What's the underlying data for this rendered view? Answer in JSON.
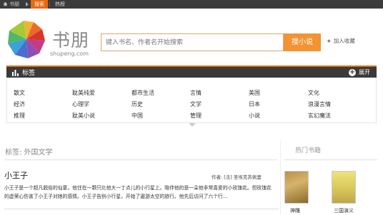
{
  "topbar": {
    "brand": "书朋",
    "active_tab": "搜索",
    "second_tab": "热榜"
  },
  "header": {
    "logo_text": "书朋",
    "logo_sub": "shupeng.com",
    "search_placeholder": "键入书名、作者名开始搜索",
    "search_button": "搜小说",
    "favorite_label": "加入收藏"
  },
  "tag_panel": {
    "title": "标签",
    "expand_label": "展开",
    "rows": [
      [
        "散文",
        "耽美纯爱",
        "都市生活",
        "言情",
        "美国",
        "文化"
      ],
      [
        "经济",
        "心理学",
        "历史",
        "文学",
        "日本",
        "浪漫言情"
      ],
      [
        "推理",
        "耽美小说",
        "中国",
        "管理",
        "小说",
        "玄幻魔法"
      ]
    ]
  },
  "section": {
    "title": "标签: 外国文学"
  },
  "hot": {
    "title": "热门书籍",
    "books": [
      {
        "label": "神雕"
      },
      {
        "label": "三国演义"
      }
    ]
  },
  "book": {
    "title": "小王子",
    "author": "作者: [法] 圣埃克苏佩里",
    "desc_line1": "小王子是一个超凡脱俗的仙童，他住在一颗只比他大一丁点儿的小行星上。陪伴他的是一朵他非常喜爱的小玫瑰花。但玫瑰花",
    "desc_line2": "的虚荣心伤害了小王子对她的感情。小王子告别小行星，开始了遨游太空的旅行。他先后访问了六个行..."
  },
  "colors": {
    "accent": "#f39333",
    "dark_bar": "#3a3a3a",
    "topbar": "#3b3b3b"
  }
}
